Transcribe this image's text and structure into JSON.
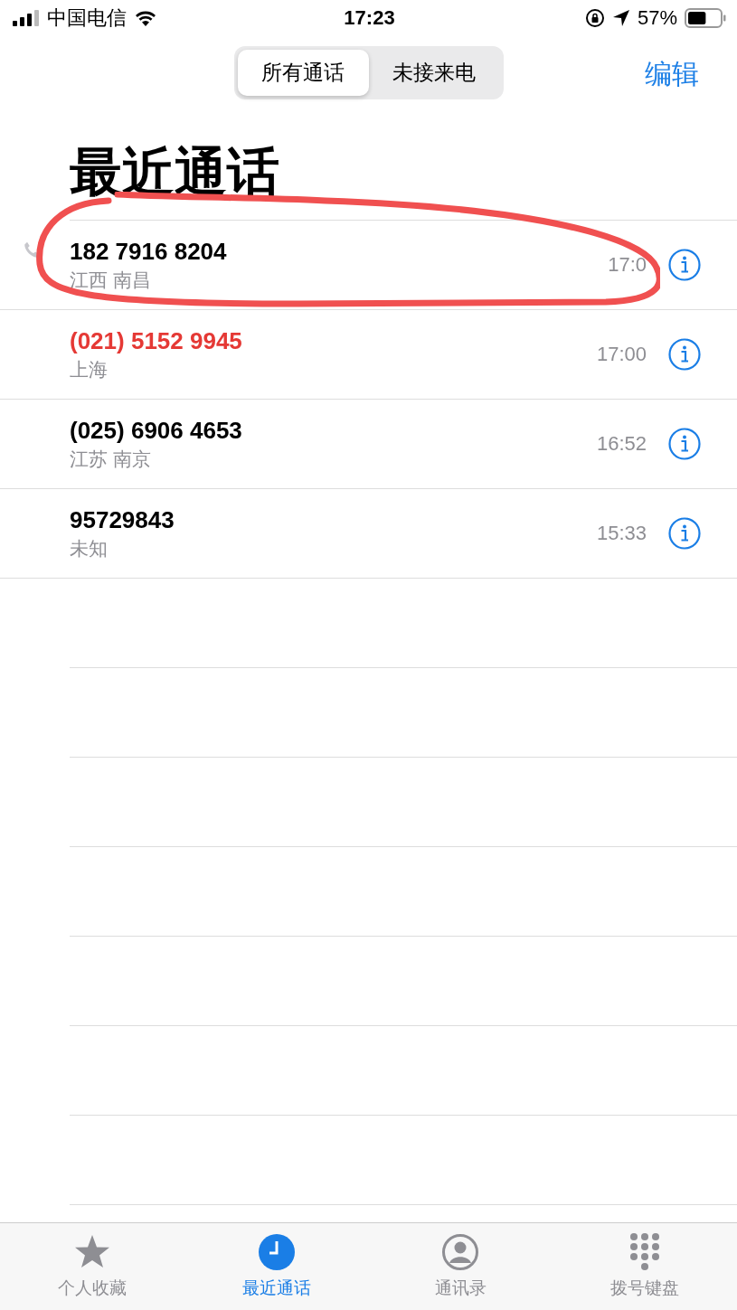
{
  "status_bar": {
    "carrier": "中国电信",
    "time": "17:23",
    "battery": "57%"
  },
  "segments": [
    {
      "label": "所有通话",
      "selected": true
    },
    {
      "label": "未接来电",
      "selected": false
    }
  ],
  "edit_button": "编辑",
  "title": "最近通话",
  "calls": [
    {
      "number": "182 7916 8204",
      "location": "江西 南昌",
      "time": "17:0",
      "missed": false,
      "outgoing": true,
      "circled": true
    },
    {
      "number": "(021) 5152 9945",
      "location": "上海",
      "time": "17:00",
      "missed": true,
      "outgoing": false,
      "circled": false
    },
    {
      "number": "(025) 6906 4653",
      "location": "江苏 南京",
      "time": "16:52",
      "missed": false,
      "outgoing": false,
      "circled": false
    },
    {
      "number": "95729843",
      "location": "未知",
      "time": "15:33",
      "missed": false,
      "outgoing": false,
      "circled": false
    }
  ],
  "tabs": [
    {
      "label": "个人收藏",
      "kind": "star",
      "selected": false
    },
    {
      "label": "最近通话",
      "kind": "clock",
      "selected": true
    },
    {
      "label": "通讯录",
      "kind": "contact",
      "selected": false
    },
    {
      "label": "拨号键盘",
      "kind": "keypad",
      "selected": false
    }
  ]
}
